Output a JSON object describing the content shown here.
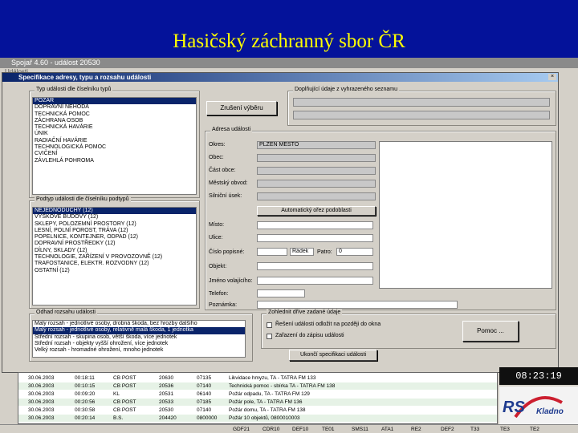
{
  "slide": {
    "title": "Hasičský záchranný sbor ČR"
  },
  "app": {
    "title": "Spojař 4.60 - událost 20530",
    "menu": "Události",
    "alert": "!!!"
  },
  "dialog": {
    "title": "Specifikace adresy, typu a rozsahu události",
    "close": "×",
    "type_group": {
      "label": "Typ události dle číselníku typů",
      "items": [
        "POŽÁR",
        "DOPRAVNÍ NEHODA",
        "TECHNICKÁ POMOC",
        "ZÁCHRANA OSOB",
        "TECHNICKÁ HAVÁRIE",
        "ÚNIK",
        "RADIAČNÍ HAVÁRIE",
        "TECHNOLOGICKÁ POMOC",
        "CVIČENÍ",
        "ZÁVLEHLÁ POHROMA"
      ],
      "selected_index": 0
    },
    "clear_button": "Zrušení výběru",
    "registry_group": {
      "label": "Doplňující údaje z vyhrazeného seznamu"
    },
    "subtype_group": {
      "label": "Podtyp události dle číselníku podtypů",
      "items": [
        "NEJEDNODUCHÝ (12)",
        "VÝŠKOVÉ BUDOVY (12)",
        "SKLEPY, POLOZEMNÍ PROSTORY (12)",
        "LESNÍ, POLNÍ POROST, TRÁVA (12)",
        "POPELNICE, KONTEJNER, ODPAD (12)",
        "DOPRAVNÍ PROSTŘEDKY (12)",
        "DÍLNY, SKLADY (12)",
        "TECHNOLOGIE, ZAŘÍZENÍ V PROVOZOVNĚ (12)",
        "TRAFOSTANICE, ELEKTR. ROZVODNY (12)",
        "OSTATNÍ (12)"
      ],
      "selected_index": 0
    },
    "address_group": {
      "label": "Adresa události",
      "fields": [
        {
          "label": "Okres:",
          "value": "PLZEŇ MĚSTO"
        },
        {
          "label": "Obec:",
          "value": ""
        },
        {
          "label": "Část obce:",
          "value": ""
        },
        {
          "label": "Městský obvod:",
          "value": ""
        },
        {
          "label": "Silniční úsek:",
          "value": ""
        }
      ],
      "auto_button": "Automatický ořez podoblasti",
      "lower_fields": [
        {
          "label": "Místo:",
          "value": ""
        },
        {
          "label": "Ulice:",
          "value": ""
        },
        {
          "label": "Číslo popisné:",
          "value": ""
        },
        {
          "label": "Objekt:",
          "value": ""
        },
        {
          "label": "Jméno volajícího:",
          "value": ""
        },
        {
          "label": "Telefon:",
          "value": ""
        },
        {
          "label": "Poznámka:",
          "value": ""
        }
      ],
      "house_type": "Řádek",
      "floor_label": "Patro:",
      "floor_value": "0"
    },
    "extent_group": {
      "label": "Odhad rozsahu události",
      "items": [
        "Malý rozsah - jednotlivé osoby, drobná škoda, bez hrozby dalšího",
        "Malý rozsah - jednotlivé osoby, relativně malá škoda, 1 jednotka",
        "Střední rozsah - skupina osob, větší škoda, více jednotek",
        "Střední rozsah - objekty vyšší ohrožení, více jednotek",
        "Velký rozsah - hromadné ohrožení, mnoho jednotek"
      ],
      "selected_index": 1
    },
    "history_group": {
      "label": "Zohlednit dříve zadané údaje",
      "checkboxes": [
        "Řešení události odložit na později do okna",
        "Zařazení do zápisu události"
      ]
    },
    "help_button": "Pomoc ...",
    "finish_button": "Ukončí specifikaci události"
  },
  "clock": "08:23:19",
  "logo": {
    "letters": "RS",
    "city": "Kladno"
  },
  "events": {
    "rows": [
      [
        "30.06.2003",
        "00:18:11",
        "CB POST",
        "20630",
        "07135",
        "Likvidace hmyzu, TA - TATRA FM 133"
      ],
      [
        "30.06.2003",
        "00:10:15",
        "CB POST",
        "20536",
        "07140",
        "Technická pomoc - sbírka TA - TATRA FM 138"
      ],
      [
        "30.06.2003",
        "00:09:20",
        "KL",
        "20531",
        "06140",
        "Požár odpadu, TA - TATRA FM 129"
      ],
      [
        "30.06.2003",
        "00:20:56",
        "CB POST",
        "20533",
        "07185",
        "Požár pole, TA - TATRA FM 136"
      ],
      [
        "30.06.2003",
        "00:30:58",
        "CB POST",
        "20530",
        "07140",
        "Požár domu, TA - TATRA FM 138"
      ],
      [
        "30.06.2003",
        "00:20:14",
        "B.S.",
        "204420",
        "0800000",
        "Požár 10 objektů, 0800010003"
      ]
    ]
  },
  "status_tabs": [
    "GDF21",
    "CDR10",
    "DEF10",
    "TE01",
    "SMS11",
    "ATA1",
    "RE2",
    "DEF2",
    "T33",
    "TE3",
    "TE2"
  ]
}
